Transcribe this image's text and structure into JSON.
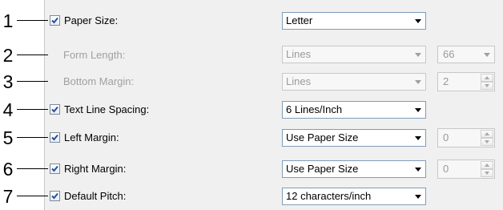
{
  "rows": [
    {
      "callout": "1",
      "label": "Paper Size:",
      "checked": true,
      "enabled": true,
      "select": "Letter"
    },
    {
      "callout": "2",
      "label": "Form Length:",
      "checked": false,
      "enabled": false,
      "select": "Lines",
      "extra_select": "66"
    },
    {
      "callout": "3",
      "label": "Bottom Margin:",
      "checked": false,
      "enabled": false,
      "select": "Lines",
      "spin": "2"
    },
    {
      "callout": "4",
      "label": "Text Line Spacing:",
      "checked": true,
      "enabled": true,
      "select": "6 Lines/Inch"
    },
    {
      "callout": "5",
      "label": "Left Margin:",
      "checked": true,
      "enabled": true,
      "select": "Use Paper Size",
      "spin": "0"
    },
    {
      "callout": "6",
      "label": "Right Margin:",
      "checked": true,
      "enabled": true,
      "select": "Use Paper Size",
      "spin": "0"
    },
    {
      "callout": "7",
      "label": "Default Pitch:",
      "checked": true,
      "enabled": true,
      "select": "12 characters/inch"
    }
  ],
  "colors": {
    "panel_bg": "#f0f0f0",
    "check_mark": "#2b4e9c",
    "disabled_text": "#a0a0a0",
    "select_border": "#7f9db9"
  },
  "icons": {
    "checkbox": "checkmark-icon",
    "dropdown": "chevron-down-icon",
    "spinner": "spinner-arrows-icon"
  }
}
